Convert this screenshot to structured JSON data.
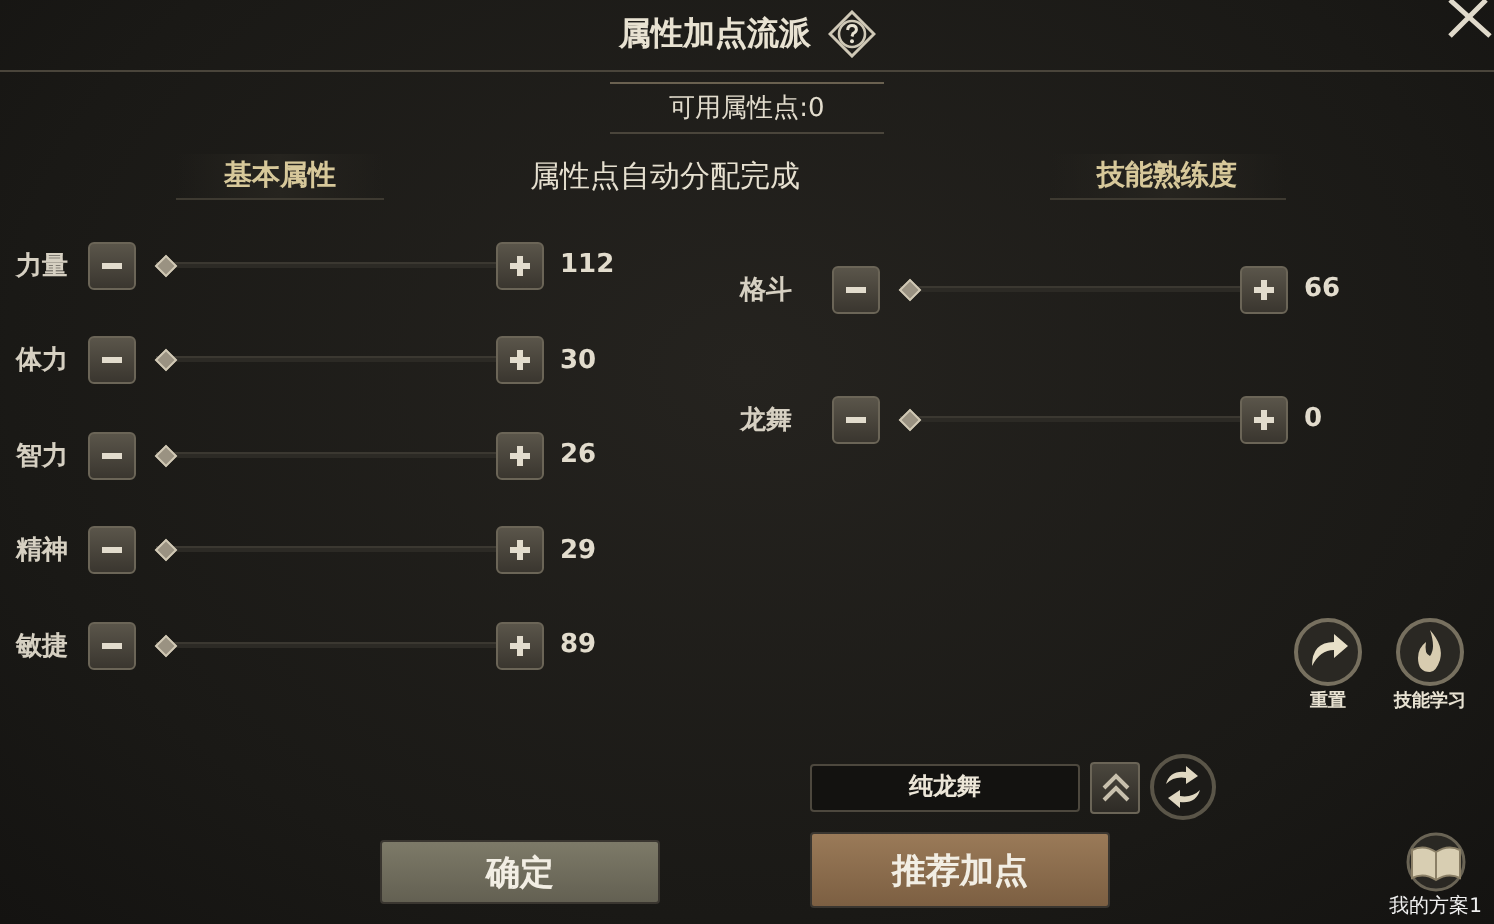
{
  "title": "属性加点流派",
  "points": "可用属性点:0",
  "status": "属性点自动分配完成",
  "sections": [
    "基本属性",
    "技能熟练度"
  ],
  "base_stats": [
    {
      "name": "力量",
      "value": "112",
      "level": 0
    },
    {
      "name": "体力",
      "value": "30",
      "level": 0
    },
    {
      "name": "智力",
      "value": "26",
      "level": 0
    },
    {
      "name": "精神",
      "value": "29",
      "level": 0
    },
    {
      "name": "敏捷",
      "value": "89",
      "level": 0
    }
  ],
  "skills": [
    {
      "name": "格斗",
      "value": "66",
      "level": 0
    },
    {
      "name": "龙舞",
      "value": "0",
      "level": 0
    }
  ],
  "actions": [
    {
      "label": "重置",
      "kind": "reset"
    },
    {
      "label": "技能学习",
      "kind": "learn"
    }
  ],
  "plan": {
    "value": "纯龙舞"
  },
  "buttons": [
    {
      "label": "确定",
      "kind": "confirm"
    },
    {
      "label": "推荐加点",
      "kind": "recommend"
    }
  ],
  "my_plan": "我的方案1"
}
